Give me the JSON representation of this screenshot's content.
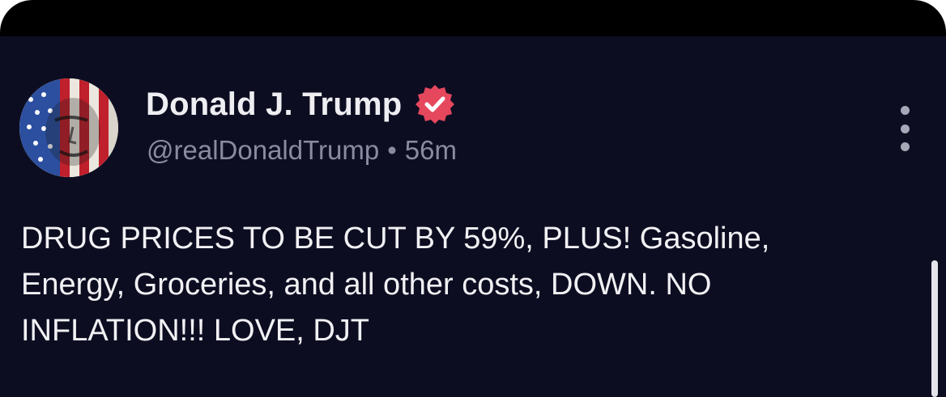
{
  "post": {
    "author_name": "Donald J. Trump",
    "handle": "@realDonaldTrump",
    "separator": "•",
    "time_ago": "56m",
    "verified_icon": "verified-badge-icon",
    "more_icon": "more-vertical-icon",
    "text": "DRUG PRICES TO BE CUT BY 59%, PLUS! Gasoline,\nEnergy, Groceries, and all other costs, DOWN. NO\nINFLATION!!! LOVE, DJT"
  },
  "colors": {
    "background": "#0d0d22",
    "badge": "#e5475c",
    "name": "#eeeef2",
    "handle": "#8a8aa0",
    "text": "#f1f1f4"
  }
}
